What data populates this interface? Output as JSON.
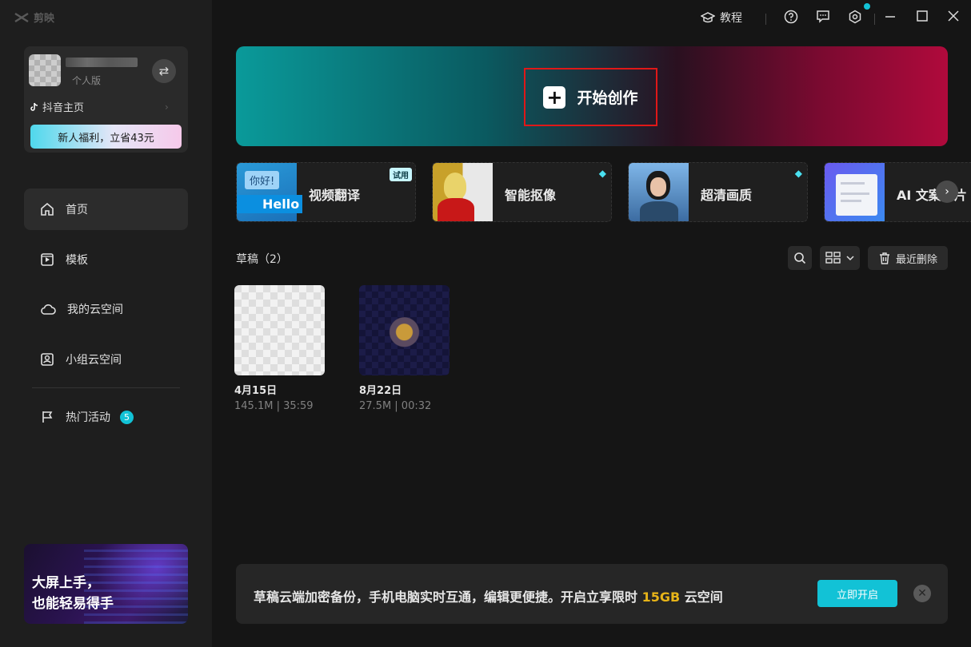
{
  "app": {
    "name": "剪映"
  },
  "user": {
    "plan": "个人版",
    "douyin_link": "抖音主页",
    "promo_button": "新人福利，立省43元"
  },
  "nav": [
    {
      "id": "home",
      "label": "首页",
      "icon": "home-icon"
    },
    {
      "id": "templates",
      "label": "模板",
      "icon": "template-icon"
    },
    {
      "id": "cloud",
      "label": "我的云空间",
      "icon": "cloud-icon"
    },
    {
      "id": "group-cloud",
      "label": "小组云空间",
      "icon": "group-cloud-icon"
    },
    {
      "id": "events",
      "label": "热门活动",
      "icon": "flag-icon",
      "badge": "5"
    }
  ],
  "sidebar_banner": {
    "line1": "大屏上手，",
    "line2": "也能轻易得手"
  },
  "titlebar": {
    "tutorial": "教程"
  },
  "hero": {
    "cta": "开始创作"
  },
  "tools": [
    {
      "label": "视频翻译",
      "tag": "试用",
      "thumb_text1": "你好!",
      "thumb_text2": "Hello"
    },
    {
      "label": "智能抠像",
      "tag": "diamond"
    },
    {
      "label": "超清画质",
      "tag": "diamond"
    },
    {
      "label": "AI 文案成片",
      "tag": ""
    }
  ],
  "drafts": {
    "title": "草稿（2）",
    "recent_delete": "最近删除",
    "items": [
      {
        "date": "4月15日",
        "meta": "145.1M | 35:59"
      },
      {
        "date": "8月22日",
        "meta": "27.5M | 00:32"
      }
    ]
  },
  "promo": {
    "text_before": "草稿云端加密备份，手机电脑实时互通，编辑更便捷。开启立享限时 ",
    "highlight": "15GB",
    "text_after": " 云空间",
    "button": "立即开启"
  },
  "colors": {
    "accent": "#12c2d6",
    "highlight": "#e7b418",
    "cta_outline": "#e01818"
  }
}
